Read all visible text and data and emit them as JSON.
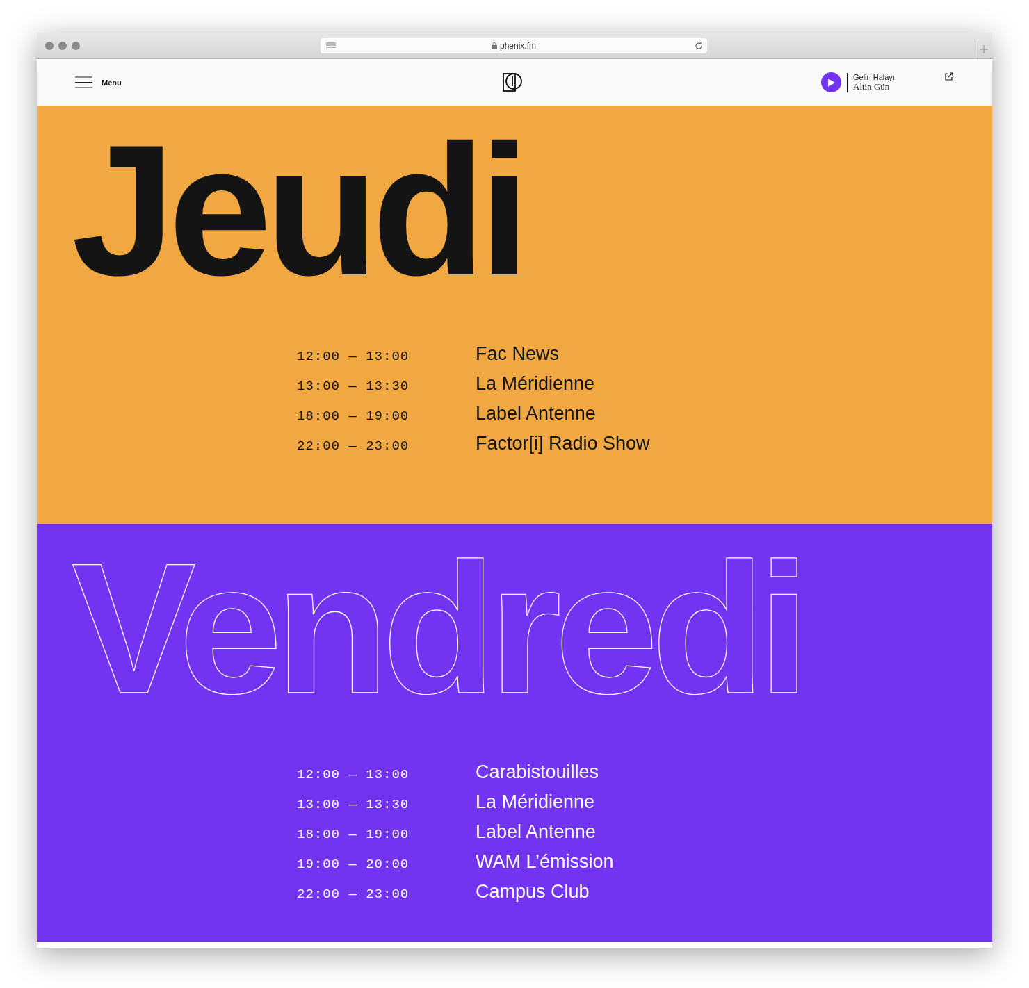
{
  "browser": {
    "url": "phenix.fm"
  },
  "header": {
    "menu_label": "Menu",
    "now_playing": {
      "title": "Gelin Halayı",
      "artist": "Altin Gün"
    }
  },
  "days": [
    {
      "name": "Jeudi",
      "kind": "filled",
      "color": "#f1a843",
      "slots": [
        {
          "time": "12:00 — 13:00",
          "show": "Fac News"
        },
        {
          "time": "13:00 — 13:30",
          "show": "La Méridienne"
        },
        {
          "time": "18:00 — 19:00",
          "show": "Label Antenne"
        },
        {
          "time": "22:00 — 23:00",
          "show": "Factor[i] Radio Show"
        }
      ]
    },
    {
      "name": "Vendredi",
      "kind": "outline",
      "color": "#7234f1",
      "slots": [
        {
          "time": "12:00 — 13:00",
          "show": "Carabistouilles"
        },
        {
          "time": "13:00 — 13:30",
          "show": "La Méridienne"
        },
        {
          "time": "18:00 — 19:00",
          "show": "Label Antenne"
        },
        {
          "time": "19:00 — 20:00",
          "show": "WAM L’émission"
        },
        {
          "time": "22:00 — 23:00",
          "show": "Campus Club"
        }
      ]
    }
  ]
}
